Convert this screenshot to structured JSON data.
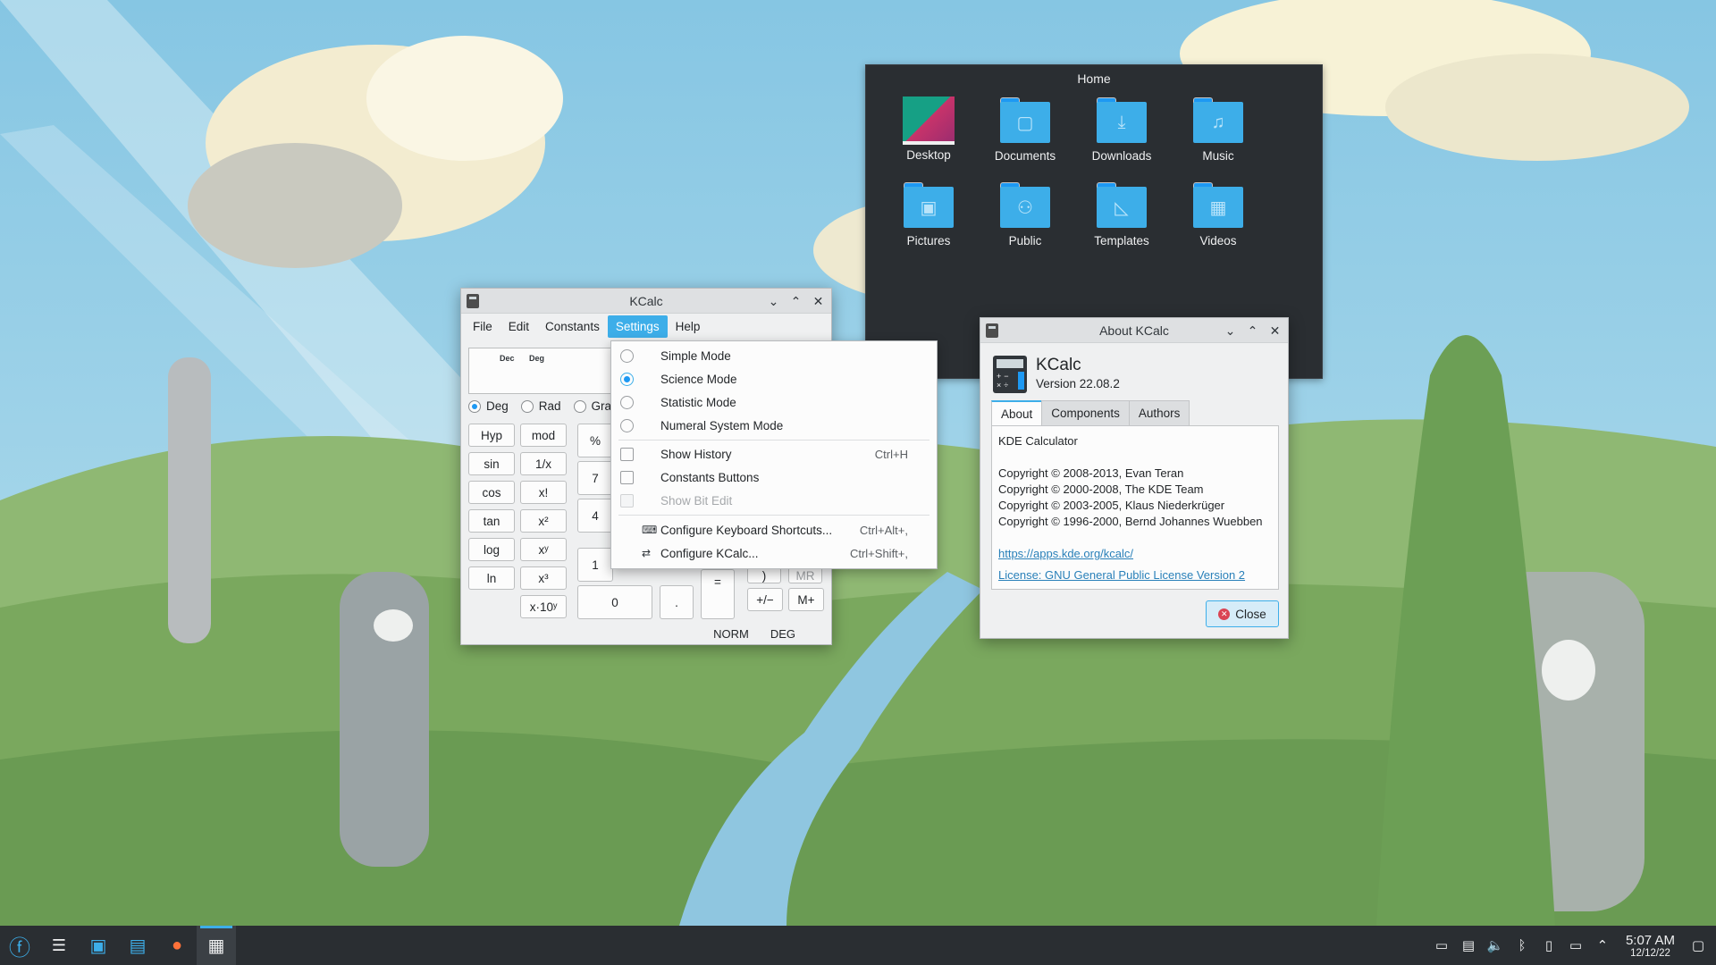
{
  "folder_view": {
    "title": "Home",
    "items": [
      {
        "label": "Desktop",
        "icon": "desktop-icon"
      },
      {
        "label": "Documents",
        "icon": "documents-folder-icon",
        "glyph": "▢"
      },
      {
        "label": "Downloads",
        "icon": "downloads-folder-icon",
        "glyph": "⤓"
      },
      {
        "label": "Music",
        "icon": "music-folder-icon",
        "glyph": "♫"
      },
      {
        "label": "Pictures",
        "icon": "pictures-folder-icon",
        "glyph": "▣"
      },
      {
        "label": "Public",
        "icon": "public-folder-icon",
        "glyph": "⚇"
      },
      {
        "label": "Templates",
        "icon": "templates-folder-icon",
        "glyph": "◺"
      },
      {
        "label": "Videos",
        "icon": "videos-folder-icon",
        "glyph": "▦"
      }
    ]
  },
  "kcalc": {
    "title": "KCalc",
    "menu": [
      "File",
      "Edit",
      "Constants",
      "Settings",
      "Help"
    ],
    "display_flags": "Dec Deg",
    "angle_modes": [
      "Deg",
      "Rad",
      "Gra"
    ],
    "keys": {
      "hyp": "Hyp",
      "mod": "mod",
      "sin": "sin",
      "inv": "1/x",
      "cos": "cos",
      "fact": "x!",
      "tan": "tan",
      "sq": "x²",
      "log": "log",
      "pow": "xʸ",
      "ln": "ln",
      "cube": "x³",
      "exp": "x·10ʸ",
      "pct": "%",
      "seven": "7",
      "four": "4",
      "one": "1",
      "zero": "0",
      "dot": ".",
      "eq": "=",
      "rparen": ")",
      "mr": "MR",
      "sign": "+/−",
      "mplus": "M+"
    },
    "status": [
      "NORM",
      "DEG"
    ]
  },
  "settings_menu": {
    "modes": [
      "Simple Mode",
      "Science Mode",
      "Statistic Mode",
      "Numeral System Mode"
    ],
    "show_history": {
      "label": "Show History",
      "shortcut": "Ctrl+H"
    },
    "constants_buttons": "Constants Buttons",
    "show_bit_edit": "Show Bit Edit",
    "configure_shortcuts": {
      "label": "Configure Keyboard Shortcuts...",
      "shortcut": "Ctrl+Alt+,"
    },
    "configure_kcalc": {
      "label": "Configure KCalc...",
      "shortcut": "Ctrl+Shift+,"
    }
  },
  "about": {
    "title": "About KCalc",
    "app_name": "KCalc",
    "version": "Version 22.08.2",
    "tabs": [
      "About",
      "Components",
      "Authors"
    ],
    "description": "KDE Calculator",
    "copyrights": [
      "Copyright © 2008-2013, Evan Teran",
      "Copyright © 2000-2008, The KDE Team",
      "Copyright © 2003-2005, Klaus Niederkrüger",
      "Copyright © 1996-2000, Bernd Johannes Wuebben"
    ],
    "url": "https://apps.kde.org/kcalc/",
    "license": "License: GNU General Public License Version 2",
    "close": "Close"
  },
  "taskbar": {
    "time": "5:07 AM",
    "date": "12/12/22"
  },
  "colors": {
    "accent": "#3daee9",
    "panel": "#2a2e32",
    "window": "#eff0f1"
  }
}
